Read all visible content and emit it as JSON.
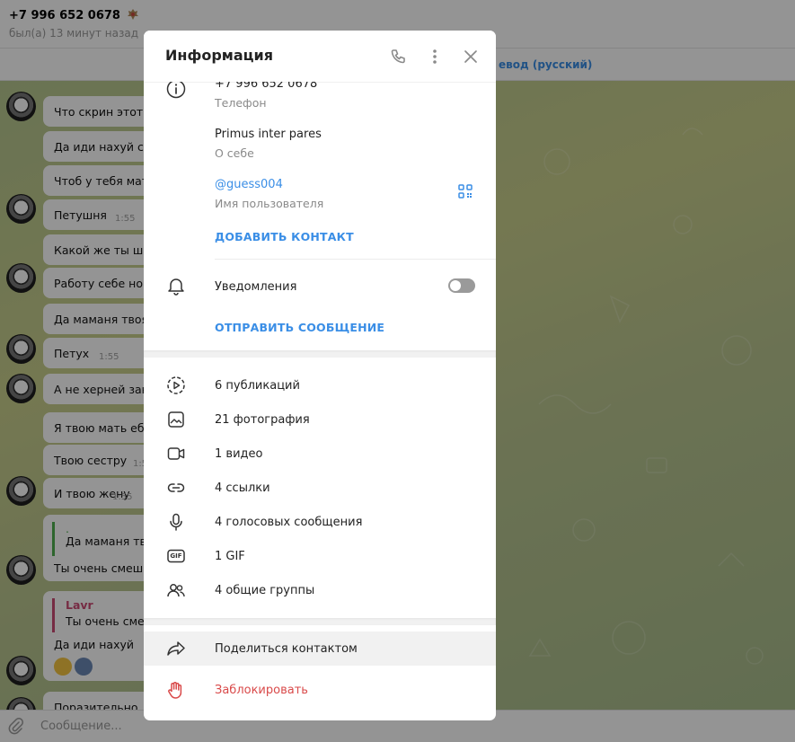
{
  "chat": {
    "header": {
      "phone": "+7 996 652 0678",
      "status": "был(а) 13 минут назад"
    },
    "translate_label": "евод (русский)",
    "messages": [
      {
        "text": "Что скрин этот д"
      },
      {
        "text": "Да иди нахуй сы"
      },
      {
        "text": "Чтоб у тебя мат"
      },
      {
        "text": "Петушня",
        "time": "1:55"
      },
      {
        "text": "Какой же ты шк"
      },
      {
        "text": "Работу себе нор"
      },
      {
        "text": "Да маманя твоя"
      },
      {
        "text": "Петух",
        "time": "1:55"
      },
      {
        "text": "А не херней зан"
      },
      {
        "text": "Я твою мать еба"
      },
      {
        "text": "Твою сестру",
        "time": "1:5"
      },
      {
        "text": "И твою жену",
        "time": "1:55"
      }
    ],
    "reply1": {
      "quote_dot": ".",
      "quote_text": "Да маманя тво",
      "text": "Ты очень смеш"
    },
    "reply2": {
      "quote_name": "Lavr",
      "quote_text": "Ты очень смеш",
      "text": "Да иди нахуй"
    },
    "last_message": "Поразительно",
    "composer_placeholder": "Сообщение..."
  },
  "modal": {
    "title": "Информация",
    "phone": {
      "value": "+7 996 652 0678",
      "label": "Телефон"
    },
    "about": {
      "value": "Primus inter pares",
      "label": "О себе"
    },
    "username": {
      "value": "@guess004",
      "label": "Имя пользователя"
    },
    "add_contact": "ДОБАВИТЬ КОНТАКТ",
    "notifications": {
      "label": "Уведомления",
      "enabled": false
    },
    "send_message": "ОТПРАВИТЬ СООБЩЕНИЕ",
    "media": [
      {
        "icon": "stories-icon",
        "label": "6 публикаций"
      },
      {
        "icon": "photo-icon",
        "label": "21 фотография"
      },
      {
        "icon": "video-icon",
        "label": "1 видео"
      },
      {
        "icon": "link-icon",
        "label": "4 ссылки"
      },
      {
        "icon": "microphone-icon",
        "label": "4 голосовых сообщения"
      },
      {
        "icon": "gif-icon",
        "label": "1 GIF",
        "badge": "GIF"
      },
      {
        "icon": "groups-icon",
        "label": "4 общие группы"
      }
    ],
    "share_contact": "Поделиться контактом",
    "block": "Заблокировать"
  },
  "colors": {
    "accent": "#3a8ee6",
    "danger": "#d94a4a",
    "reply_green": "#4fae4e",
    "reply_pink": "#cc4a74"
  }
}
